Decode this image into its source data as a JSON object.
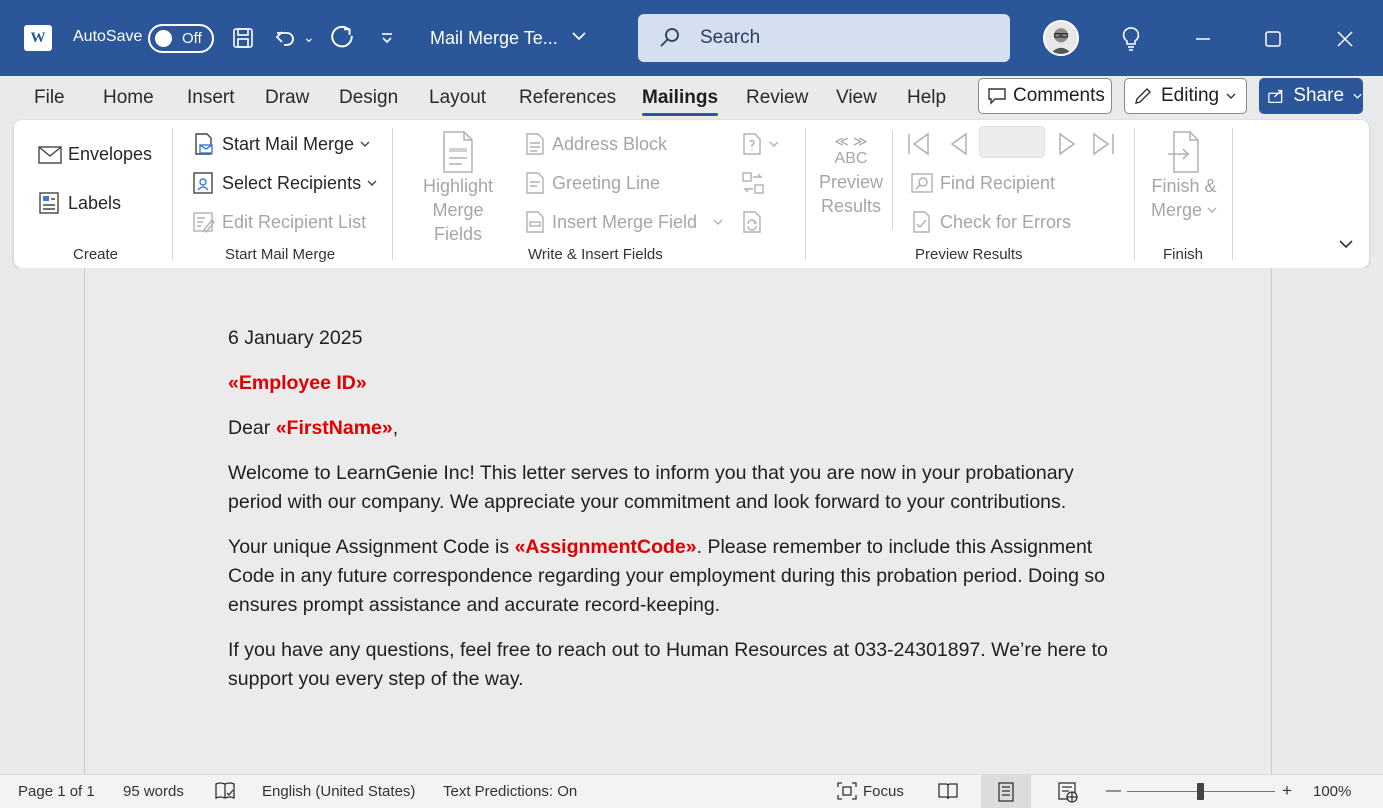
{
  "titlebar": {
    "autosave_label": "AutoSave",
    "autosave_state": "Off",
    "doc_title": "Mail Merge Te...",
    "search_placeholder": "Search"
  },
  "tabs": [
    "File",
    "Home",
    "Insert",
    "Draw",
    "Design",
    "Layout",
    "References",
    "Mailings",
    "Review",
    "View",
    "Help"
  ],
  "active_tab": "Mailings",
  "tab_actions": {
    "comments": "Comments",
    "editing": "Editing",
    "share": "Share"
  },
  "ribbon": {
    "create": {
      "envelopes": "Envelopes",
      "labels": "Labels",
      "group": "Create"
    },
    "start": {
      "start_mail_merge": "Start Mail Merge",
      "select_recipients": "Select Recipients",
      "edit_recipient_list": "Edit Recipient List",
      "group": "Start Mail Merge"
    },
    "write": {
      "highlight_1": "Highlight",
      "highlight_2": "Merge Fields",
      "address_block": "Address Block",
      "greeting_line": "Greeting Line",
      "insert_merge_field": "Insert Merge Field",
      "group": "Write & Insert Fields"
    },
    "preview": {
      "abc": "ABC",
      "preview_1": "Preview",
      "preview_2": "Results",
      "find_recipient": "Find Recipient",
      "check_errors": "Check for Errors",
      "group": "Preview Results"
    },
    "finish": {
      "finish_1": "Finish &",
      "finish_2": "Merge",
      "group": "Finish"
    }
  },
  "document": {
    "date": "6 January 2025",
    "employee_field": "«Employee ID»",
    "dear": "Dear ",
    "firstname_field": "«FirstName»",
    "dear_comma": ",",
    "para1": "Welcome to LearnGenie Inc! This letter serves to inform you that you are now in your probationary period with our company. We appreciate your commitment and look forward to your contributions.",
    "para2_a": "Your unique Assignment Code is ",
    "assignment_field": "«AssignmentCode»",
    "para2_b": ". Please remember to include this Assignment Code in any future correspondence regarding your employment during this probation period. Doing so ensures prompt assistance and accurate record-keeping.",
    "para3": "If you have any questions, feel free to reach out to Human Resources at 033-24301897. We’re here to support you every step of the way."
  },
  "statusbar": {
    "page": "Page 1 of 1",
    "words": "95 words",
    "language": "English (United States)",
    "predictions": "Text Predictions: On",
    "focus": "Focus",
    "zoom": "100%",
    "zoom_minus": "—",
    "zoom_plus": "+"
  }
}
